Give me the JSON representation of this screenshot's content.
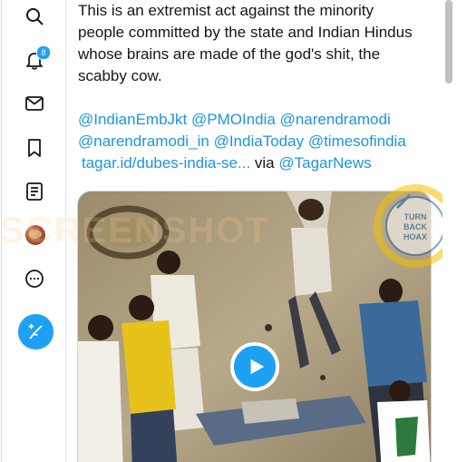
{
  "sidebar": {
    "items": [
      {
        "icon": "search-icon",
        "label": ""
      },
      {
        "icon": "bell-icon",
        "label": "",
        "badge": "8"
      },
      {
        "icon": "mail-icon",
        "label": ""
      },
      {
        "icon": "bookmark-icon",
        "label": ""
      },
      {
        "icon": "list-icon",
        "label": ""
      },
      {
        "icon": "avatar",
        "label": ""
      },
      {
        "icon": "more-icon",
        "label": ""
      }
    ],
    "notification_badge": "8",
    "compose_icon": "compose-icon"
  },
  "tweet": {
    "lines": [
      "This is an extremist act against the minority",
      "people committed by the state and Indian Hindus",
      "whose brains are made of the god's shit, the",
      "scabby cow."
    ],
    "mentions_line1": [
      "@IndianEmbJkt",
      "@PMOIndia",
      "@narendramodi"
    ],
    "mentions_line2": [
      "@narendramodi_in",
      "@IndiaToday",
      "@timesofindia"
    ],
    "link_text": "tagar.id/dubes-india-se...",
    "via_text": "via",
    "via_mention": "@TagarNews"
  },
  "media": {
    "type": "video",
    "play_icon": "play-icon",
    "watermark": "SCREENSHOT",
    "seal_text": [
      "TURN",
      "BACK",
      "HOAX"
    ]
  },
  "colors": {
    "accent": "#1da1f2",
    "link": "#1b95e0",
    "text": "#14171a",
    "icon": "#14171a"
  }
}
